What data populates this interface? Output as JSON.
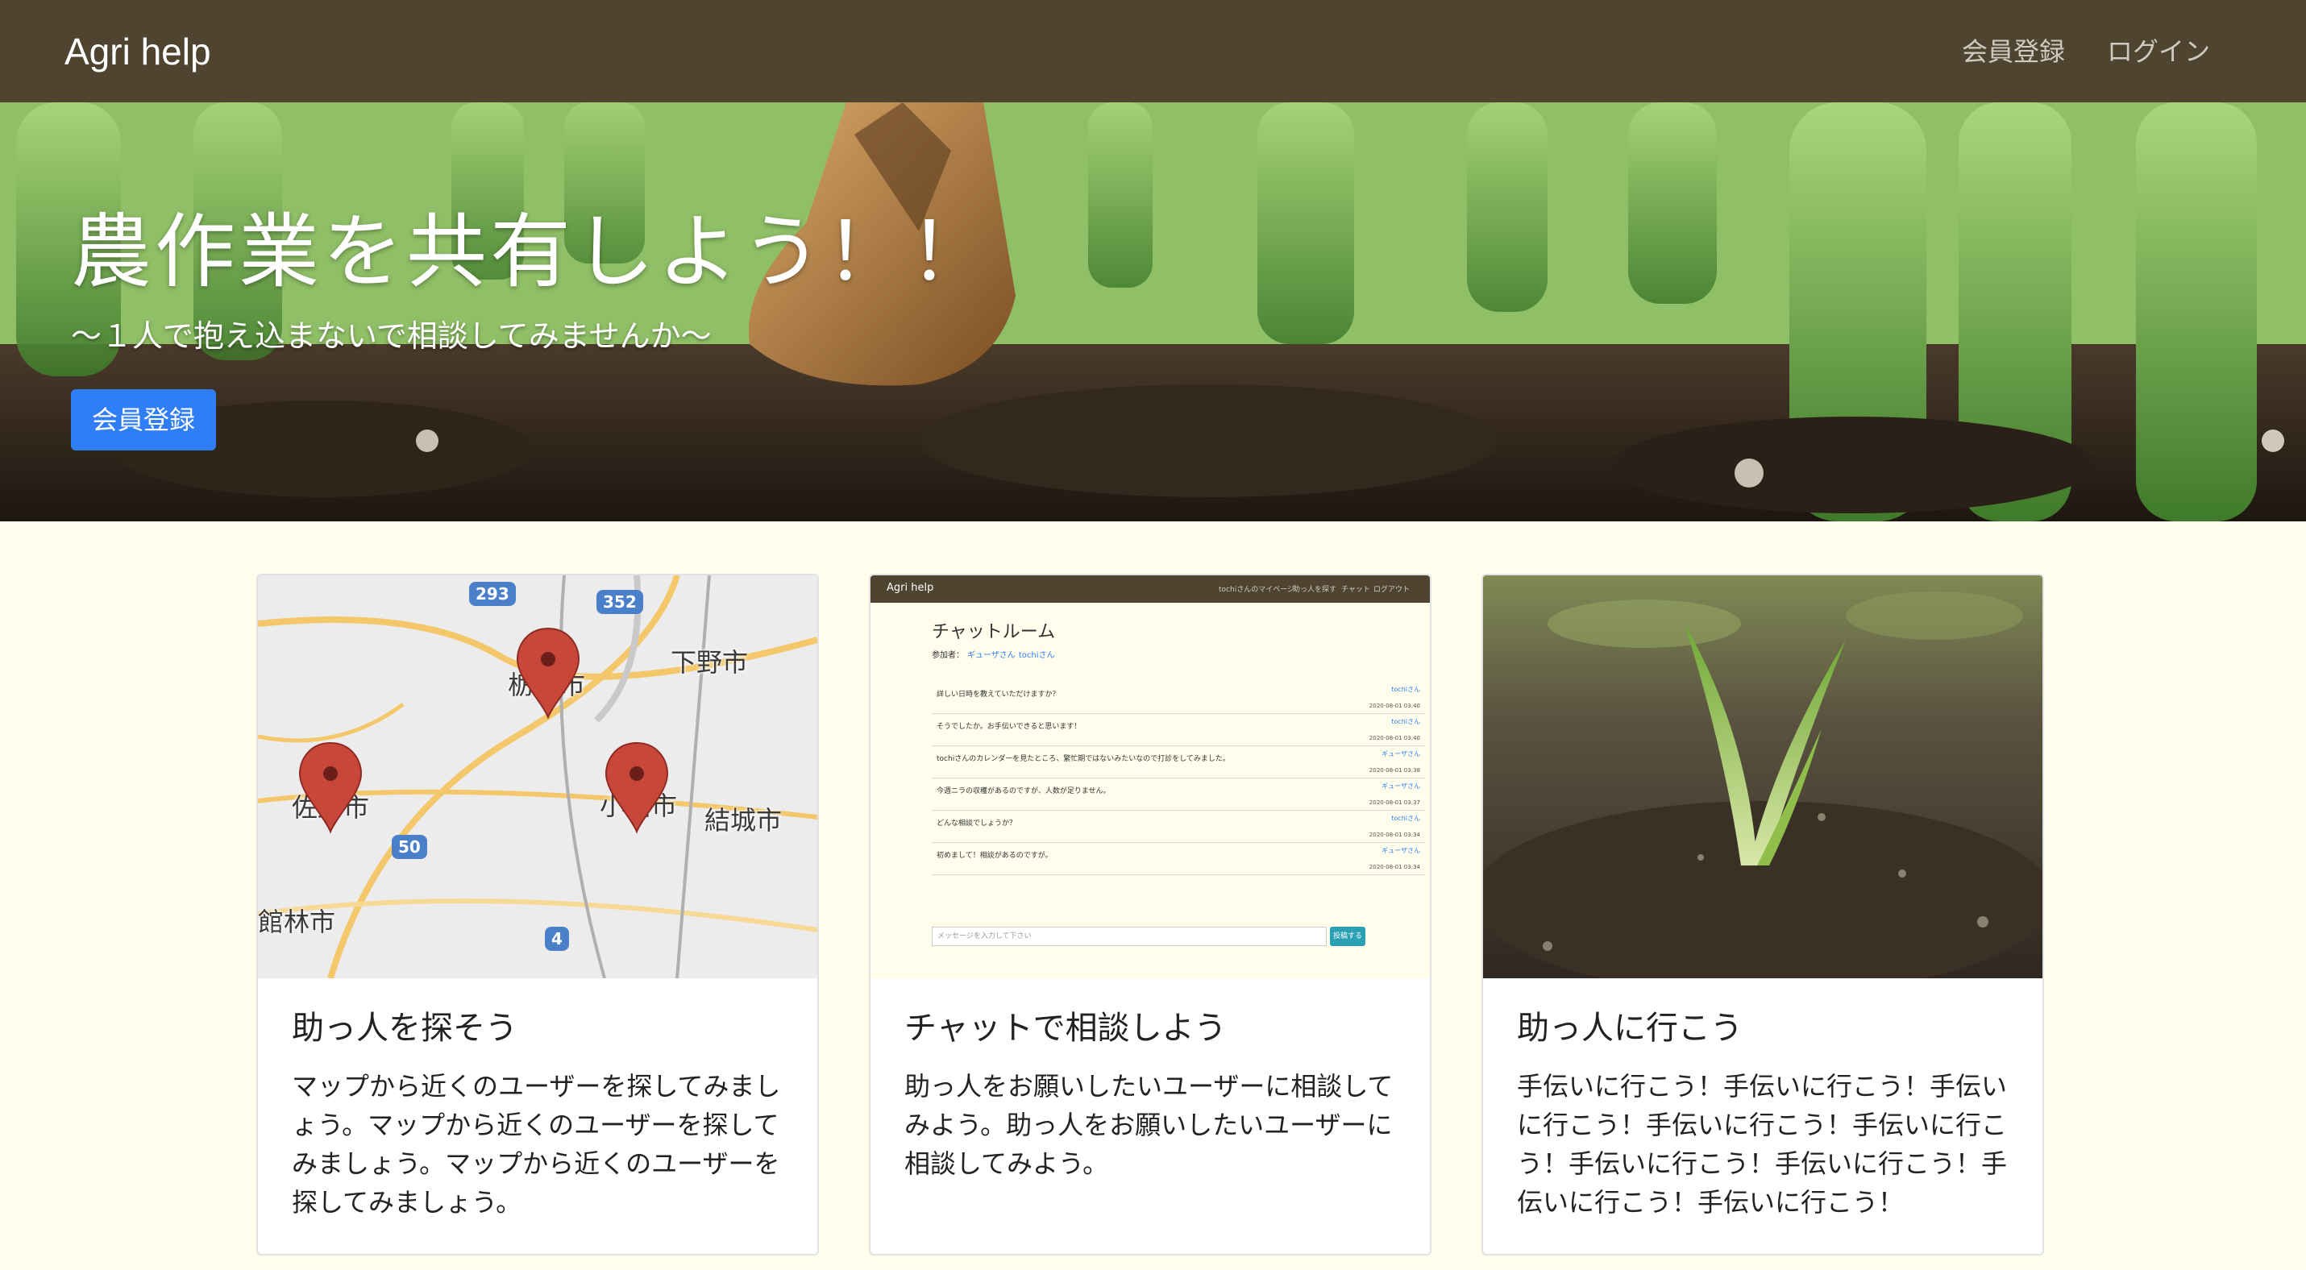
{
  "navbar": {
    "brand": "Agri help",
    "signup_label": "会員登録",
    "login_label": "ログイン"
  },
  "hero": {
    "title": "農作業を共有しよう！！",
    "subtitle": "〜１人で抱え込まないで相談してみませんか〜",
    "button_label": "会員登録"
  },
  "cards": [
    {
      "title": "助っ人を探そう",
      "text": "マップから近くのユーザーを探してみましょう。マップから近くのユーザーを探してみましょう。マップから近くのユーザーを探してみましょう。",
      "map": {
        "labels": [
          "佐野市",
          "栃木市",
          "下野市",
          "小山市",
          "結城市",
          "館林市"
        ],
        "badges": [
          "293",
          "352",
          "50",
          "4"
        ]
      }
    },
    {
      "title": "チャットで相談しよう",
      "text": "助っ人をお願いしたいユーザーに相談してみよう。助っ人をお願いしたいユーザーに相談してみよう。",
      "screenshot": {
        "brand": "Agri help",
        "nav_links": [
          "tochiさんのマイページ",
          "助っ人を探す",
          "チャット",
          "ログアウト"
        ],
        "room_title": "チャットルーム",
        "members_label": "参加者：",
        "members": [
          "ギューザさん",
          "tochiさん"
        ],
        "messages": [
          {
            "text": "詳しい日時を教えていただけますか？",
            "who": "tochiさん",
            "when": "2020-08-01 03:40"
          },
          {
            "text": "そうでしたか。お手伝いできると思います！",
            "who": "tochiさん",
            "when": "2020-08-01 03:40"
          },
          {
            "text": "tochiさんのカレンダーを見たところ、繁忙期ではないみたいなので打診をしてみました。",
            "who": "ギューザさん",
            "when": "2020-08-01 03:38"
          },
          {
            "text": "今週ニラの収穫があるのですが、人数が足りません。",
            "who": "ギューザさん",
            "when": "2020-08-01 03:37"
          },
          {
            "text": "どんな相談でしょうか？",
            "who": "tochiさん",
            "when": "2020-08-01 03:34"
          },
          {
            "text": "初めまして！相談があるのですが。",
            "who": "ギューザさん",
            "when": "2020-08-01 03:34"
          }
        ],
        "input_placeholder": "メッセージを入力して下さい",
        "send_label": "投稿する"
      }
    },
    {
      "title": "助っ人に行こう",
      "text": "手伝いに行こう！手伝いに行こう！手伝いに行こう！手伝いに行こう！手伝いに行こう！手伝いに行こう！手伝いに行こう！手伝いに行こう！手伝いに行こう！"
    }
  ],
  "colors": {
    "navbar_bg": "#4f4430",
    "page_bg": "#fffdec",
    "primary_button": "#2f7ef6",
    "map_pin": "#c8473b"
  }
}
